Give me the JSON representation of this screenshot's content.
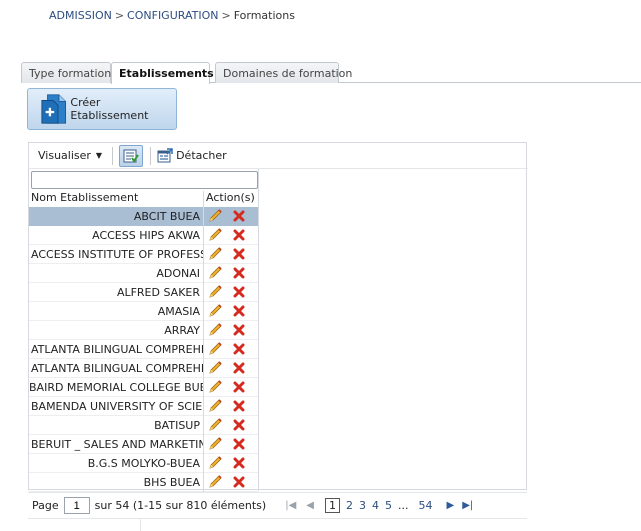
{
  "breadcrumb": {
    "part1": "ADMISSION",
    "sep1": ">",
    "part2": "CONFIGURATION",
    "sep2": ">",
    "current": "Formations"
  },
  "tabs": [
    {
      "label": "Type formation",
      "active": false
    },
    {
      "label": "Etablissements",
      "active": true
    },
    {
      "label": "Domaines de formation",
      "active": false
    }
  ],
  "create_button": {
    "label": "Créer Etablissement"
  },
  "toolbar": {
    "view_label": "Visualiser",
    "detach_label": "Détacher"
  },
  "table": {
    "columns": [
      "Nom Etablissement",
      "Action(s)"
    ],
    "filter_value": "",
    "rows": [
      {
        "name": "ABCIT BUEA",
        "selected": true
      },
      {
        "name": "ACCESS HIPS AKWA",
        "selected": false
      },
      {
        "name": "ACCESS INSTITUTE OF PROFESS...",
        "selected": false
      },
      {
        "name": "ADONAI",
        "selected": false
      },
      {
        "name": "ALFRED SAKER",
        "selected": false
      },
      {
        "name": "AMASIA",
        "selected": false
      },
      {
        "name": "ARRAY",
        "selected": false
      },
      {
        "name": "ATLANTA BILINGUAL COMPREHE...",
        "selected": false
      },
      {
        "name": "ATLANTA BILINGUAL COMPREHE...",
        "selected": false
      },
      {
        "name": "BAIRD MEMORIAL COLLEGE BUEA",
        "selected": false
      },
      {
        "name": "BAMENDA UNIVERSITY OF SCIEN...",
        "selected": false
      },
      {
        "name": "BATISUP",
        "selected": false
      },
      {
        "name": "BERUIT _ SALES AND MARKETIN...",
        "selected": false
      },
      {
        "name": "B.G.S MOLYKO-BUEA",
        "selected": false
      },
      {
        "name": "BHS BUEA",
        "selected": false
      }
    ]
  },
  "pager": {
    "page_label": "Page",
    "page_value": "1",
    "summary": "sur 54 (1-15 sur 810 éléments)",
    "current_page": "1",
    "pages": [
      "2",
      "3",
      "4",
      "5"
    ],
    "ellipsis": "...",
    "last_page": "54"
  },
  "colors": {
    "link": "#2d4d80",
    "selected_row": "#a9bdd3",
    "delete": "#d42a1f",
    "edit": "#e0a020"
  },
  "icons": {
    "create": "document-add-icon",
    "qbe": "query-filter-icon",
    "detach": "detach-icon",
    "edit": "pencil-icon",
    "delete": "delete-x-icon",
    "first": "first-page-icon",
    "prev": "prev-page-icon",
    "next": "next-page-icon",
    "last": "last-page-icon"
  }
}
